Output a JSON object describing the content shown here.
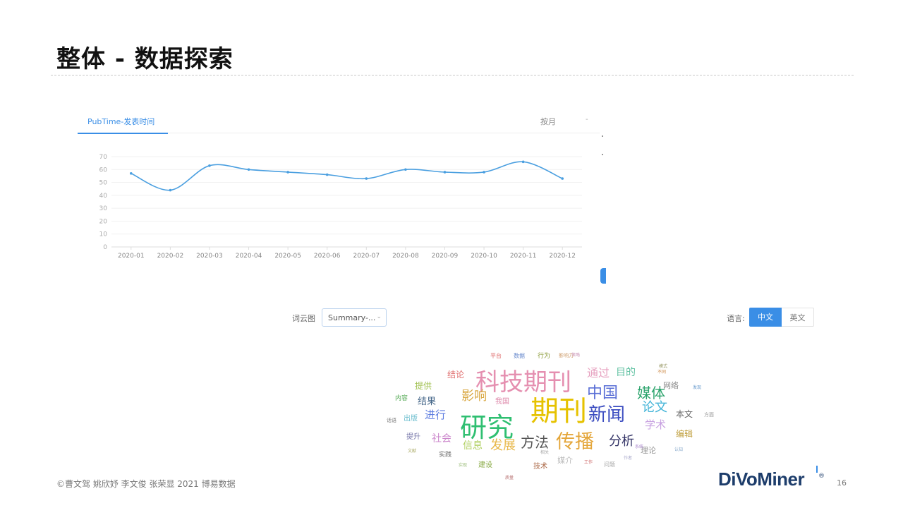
{
  "slide": {
    "title": "整体 - 数据探索",
    "copyright": "©曹文驾 姚欣妤 李文俊 张荣显 2021 博易数据",
    "logo": "DiVoMiner",
    "logo_reg": "®",
    "page_number": "16"
  },
  "chart_panel": {
    "tab_label": "PubTime-发表时间",
    "period_label": "按月",
    "period_arrow": "-"
  },
  "chart_data": {
    "type": "line",
    "x": [
      "2020-01",
      "2020-02",
      "2020-03",
      "2020-04",
      "2020-05",
      "2020-06",
      "2020-07",
      "2020-08",
      "2020-09",
      "2020-10",
      "2020-11",
      "2020-12"
    ],
    "series": [
      {
        "values": [
          57,
          44,
          63,
          60,
          58,
          56,
          53,
          60,
          58,
          58,
          66,
          53
        ],
        "color": "#4a9fe0"
      }
    ],
    "ylim": [
      0,
      70
    ],
    "yticks": [
      0,
      10,
      20,
      30,
      40,
      50,
      60,
      70
    ],
    "grid": true,
    "smooth": true
  },
  "wordcloud_toolbar": {
    "label": "词云图",
    "select_value": "Summary-...",
    "select_arrow": "⌄",
    "language_label": "语言:",
    "lang_zh": "中文",
    "lang_en": "英文"
  },
  "wordcloud": {
    "words": [
      {
        "t": "期刊",
        "c": "#e6c200",
        "s": 40
      },
      {
        "t": "研究",
        "c": "#2fbf71",
        "s": 38
      },
      {
        "t": "科技期刊",
        "c": "#e58fb0",
        "s": 34
      },
      {
        "t": "传播",
        "c": "#e4a63a",
        "s": 27
      },
      {
        "t": "新闻",
        "c": "#3b4cc0",
        "s": 26
      },
      {
        "t": "中国",
        "c": "#5a6fd6",
        "s": 22
      },
      {
        "t": "媒体",
        "c": "#2aa36b",
        "s": 20
      },
      {
        "t": "方法",
        "c": "#555555",
        "s": 20
      },
      {
        "t": "分析",
        "c": "#333366",
        "s": 18
      },
      {
        "t": "论文",
        "c": "#43b4d8",
        "s": 18
      },
      {
        "t": "影响",
        "c": "#d9a740",
        "s": 18
      },
      {
        "t": "发展",
        "c": "#e8b84a",
        "s": 18
      },
      {
        "t": "通过",
        "c": "#e7a2c0",
        "s": 16
      },
      {
        "t": "目的",
        "c": "#5dc0a0",
        "s": 14
      },
      {
        "t": "学术",
        "c": "#c7a0e0",
        "s": 15
      },
      {
        "t": "进行",
        "c": "#5f7ee0",
        "s": 15
      },
      {
        "t": "社会",
        "c": "#cc88cc",
        "s": 14
      },
      {
        "t": "信息",
        "c": "#b0d060",
        "s": 14
      },
      {
        "t": "结果",
        "c": "#446688",
        "s": 13
      },
      {
        "t": "结论",
        "c": "#e07070",
        "s": 12
      },
      {
        "t": "提供",
        "c": "#a0c050",
        "s": 12
      },
      {
        "t": "网络",
        "c": "#888888",
        "s": 11
      },
      {
        "t": "本文",
        "c": "#666666",
        "s": 12
      },
      {
        "t": "编辑",
        "c": "#c0a040",
        "s": 12
      },
      {
        "t": "理论",
        "c": "#999999",
        "s": 11
      },
      {
        "t": "媒介",
        "c": "#bbbbbb",
        "s": 11
      },
      {
        "t": "技术",
        "c": "#aa6644",
        "s": 10
      },
      {
        "t": "建设",
        "c": "#88aa44",
        "s": 10
      },
      {
        "t": "出版",
        "c": "#66bbcc",
        "s": 10
      },
      {
        "t": "提升",
        "c": "#7777aa",
        "s": 10
      },
      {
        "t": "实践",
        "c": "#666666",
        "s": 9
      },
      {
        "t": "内容",
        "c": "#55aa55",
        "s": 9
      },
      {
        "t": "平台",
        "c": "#dd6666",
        "s": 8
      },
      {
        "t": "数据",
        "c": "#6688cc",
        "s": 8
      },
      {
        "t": "行为",
        "c": "#889933",
        "s": 9
      },
      {
        "t": "影响力",
        "c": "#cc9966",
        "s": 7
      },
      {
        "t": "我国",
        "c": "#dd88aa",
        "s": 10
      },
      {
        "t": "问题",
        "c": "#aaaaaa",
        "s": 8
      },
      {
        "t": "话语",
        "c": "#777777",
        "s": 7
      },
      {
        "t": "方面",
        "c": "#999999",
        "s": 7
      },
      {
        "t": "作者",
        "c": "#aaaacc",
        "s": 6
      },
      {
        "t": "工作",
        "c": "#cc6666",
        "s": 6
      },
      {
        "t": "相关",
        "c": "#aaaaaa",
        "s": 6
      },
      {
        "t": "模式",
        "c": "#999966",
        "s": 6
      },
      {
        "t": "发现",
        "c": "#6699cc",
        "s": 6
      },
      {
        "t": "系统",
        "c": "#aa88cc",
        "s": 6
      },
      {
        "t": "不同",
        "c": "#cc8844",
        "s": 6
      },
      {
        "t": "认知",
        "c": "#88aacc",
        "s": 6
      },
      {
        "t": "文献",
        "c": "#aaaa66",
        "s": 6
      },
      {
        "t": "策略",
        "c": "#cc99bb",
        "s": 6
      },
      {
        "t": "实现",
        "c": "#99bb77",
        "s": 6
      },
      {
        "t": "质量",
        "c": "#bb7777",
        "s": 6
      }
    ]
  }
}
